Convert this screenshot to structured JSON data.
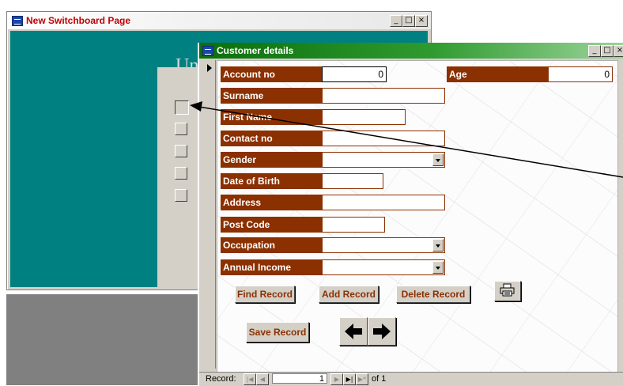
{
  "switchboard": {
    "title": "New Switchboard Page",
    "heading_partial": "Uni",
    "item_count": 5
  },
  "customer_form": {
    "title": "Customer details",
    "fields": {
      "account_no": {
        "label": "Account no",
        "value": "0"
      },
      "age": {
        "label": "Age",
        "value": "0"
      },
      "surname": {
        "label": "Surname",
        "value": ""
      },
      "first_name": {
        "label": "First Name",
        "value": ""
      },
      "contact_no": {
        "label": "Contact no",
        "value": ""
      },
      "gender": {
        "label": "Gender",
        "value": ""
      },
      "date_of_birth": {
        "label": "Date of Birth",
        "value": ""
      },
      "address": {
        "label": "Address",
        "value": ""
      },
      "post_code": {
        "label": "Post Code",
        "value": ""
      },
      "occupation": {
        "label": "Occupation",
        "value": ""
      },
      "annual_income": {
        "label": "Annual Income",
        "value": ""
      }
    },
    "buttons": {
      "find": "Find Record",
      "add": "Add Record",
      "delete": "Delete Record",
      "save": "Save Record",
      "print_icon": "printer-icon",
      "prev_icon": "arrow-left-icon",
      "next_icon": "arrow-right-icon"
    },
    "record_nav": {
      "label": "Record:",
      "current": "1",
      "of_text": "of 1"
    }
  },
  "caption_buttons": {
    "minimize": "_",
    "maximize": "□",
    "close": "×"
  },
  "colors": {
    "label_bg": "#8b3000",
    "label_text": "#ffffff",
    "button_text": "#8b3000",
    "switchboard_bg": "#008080",
    "form_title_bar": "#0b6f0b",
    "switchboard_title_text": "#c00000"
  }
}
